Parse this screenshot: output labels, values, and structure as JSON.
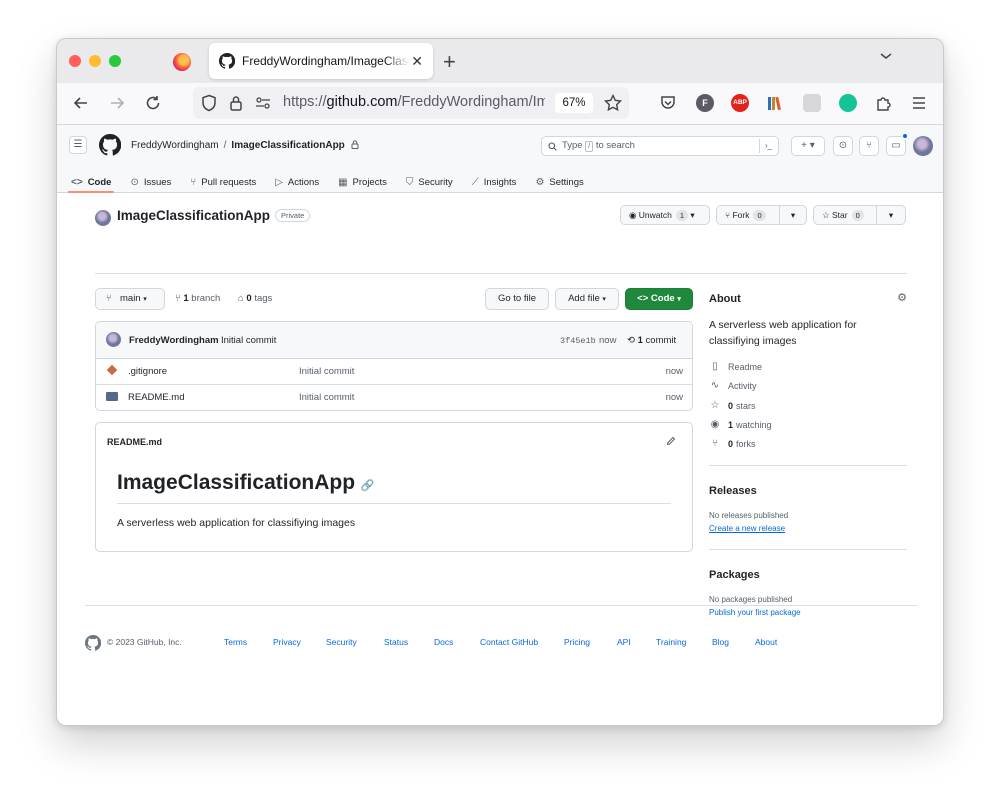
{
  "browser": {
    "tab_title": "FreddyWordingham/ImageClassificationApp",
    "tab_close": "✕",
    "new_tab": "+",
    "url_prefix": "https://",
    "url_host": "github.com",
    "url_path": "/FreddyWordingham/ImageClassificationApp",
    "zoom": "67%"
  },
  "extensions": [
    {
      "name": "pocket-icon",
      "label": "",
      "color": "#ffffff"
    },
    {
      "name": "profile-f-icon",
      "label": "F",
      "color": "#5b5b66"
    },
    {
      "name": "adblock-plus-icon",
      "label": "ABP",
      "color": "#e2231a"
    },
    {
      "name": "library-icon",
      "label": "",
      "color": "#c08a2c"
    },
    {
      "name": "extension-grey-icon",
      "label": "",
      "color": "#d7d7db"
    },
    {
      "name": "grammarly-icon",
      "label": "",
      "color": "#15c39a"
    }
  ],
  "header": {
    "owner": "FreddyWordingham",
    "separator": "/",
    "repo": "ImageClassificationApp",
    "search_prefix": "Type",
    "search_key": "/",
    "search_suffix": "to search"
  },
  "repo_nav": [
    {
      "label": "Code",
      "icon": "code-icon",
      "glyph": "<>",
      "active": true
    },
    {
      "label": "Issues",
      "icon": "issue-icon",
      "glyph": "⊙",
      "active": false
    },
    {
      "label": "Pull requests",
      "icon": "pull-request-icon",
      "glyph": "⑂",
      "active": false
    },
    {
      "label": "Actions",
      "icon": "actions-play-icon",
      "glyph": "▷",
      "active": false
    },
    {
      "label": "Projects",
      "icon": "projects-table-icon",
      "glyph": "▦",
      "active": false
    },
    {
      "label": "Security",
      "icon": "shield-icon",
      "glyph": "⛉",
      "active": false
    },
    {
      "label": "Insights",
      "icon": "graph-icon",
      "glyph": "⟋",
      "active": false
    },
    {
      "label": "Settings",
      "icon": "gear-icon",
      "glyph": "⚙",
      "active": false
    }
  ],
  "repo": {
    "title": "ImageClassificationApp",
    "visibility": "Private",
    "unwatch_label": "Unwatch",
    "unwatch_count": "1",
    "fork_label": "Fork",
    "fork_count": "0",
    "star_label": "Star",
    "star_count": "0"
  },
  "controls": {
    "branch": "main",
    "branch_count": "1",
    "branch_word": "branch",
    "tag_count": "0",
    "tag_word": "tags",
    "go_to_file": "Go to file",
    "add_file": "Add file",
    "code": "Code"
  },
  "latest_commit": {
    "author": "FreddyWordingham",
    "message": "Initial commit",
    "sha": "3f45e1b",
    "time": "now",
    "count": "1",
    "count_word": "commit"
  },
  "files": [
    {
      "name": ".gitignore",
      "icon": "gitignore-file-icon",
      "message": "Initial commit",
      "time": "now"
    },
    {
      "name": "README.md",
      "icon": "readme-file-icon",
      "message": "Initial commit",
      "time": "now"
    }
  ],
  "readme": {
    "filename": "README.md",
    "title": "ImageClassificationApp",
    "description": "A serverless web application for classifiying images"
  },
  "about": {
    "heading": "About",
    "description": "A serverless web application for classifiying images",
    "readme": "Readme",
    "activity": "Activity",
    "stars_count": "0",
    "stars_word": "stars",
    "watching_count": "1",
    "watching_word": "watching",
    "forks_count": "0",
    "forks_word": "forks"
  },
  "releases": {
    "heading": "Releases",
    "empty": "No releases published",
    "link": "Create a new release"
  },
  "packages": {
    "heading": "Packages",
    "empty": "No packages published",
    "link": "Publish your first package"
  },
  "footer": {
    "copyright": "© 2023 GitHub, Inc.",
    "links": [
      "Terms",
      "Privacy",
      "Security",
      "Status",
      "Docs",
      "Contact GitHub",
      "Pricing",
      "API",
      "Training",
      "Blog",
      "About"
    ]
  },
  "colors": {
    "green_button": "#1f883d",
    "link_blue": "#0969da",
    "active_tab_underline": "#fd8c73"
  }
}
